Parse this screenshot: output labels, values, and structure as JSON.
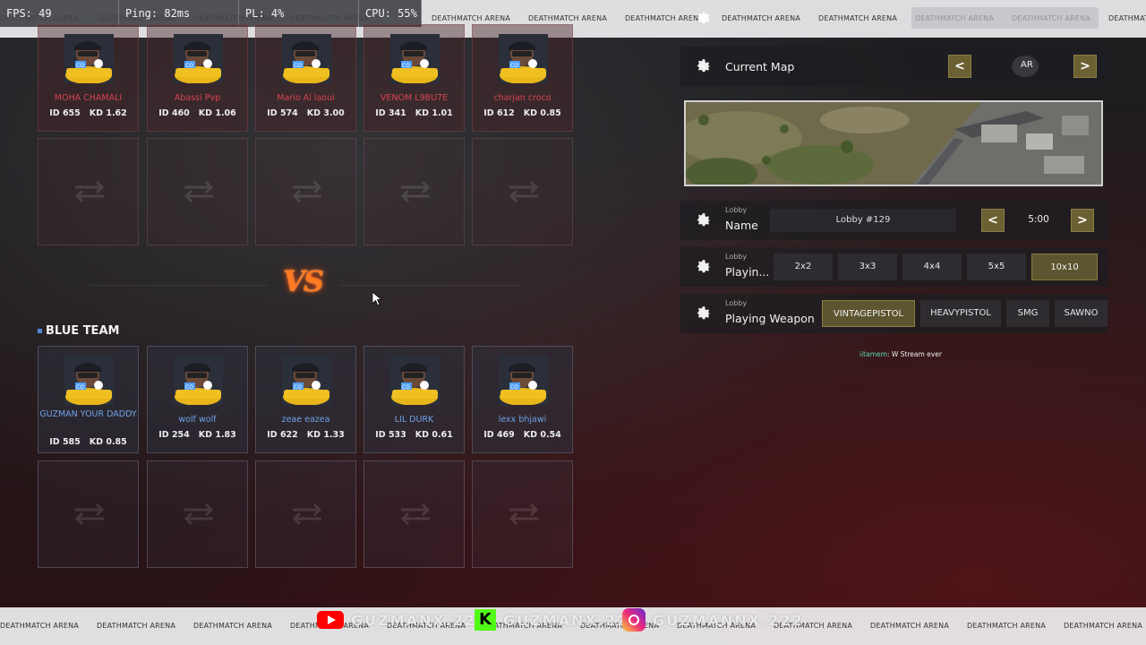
{
  "stats": {
    "fps": "FPS: 49",
    "ping": "Ping: 82ms",
    "pl": "PL: 4%",
    "cpu": "CPU: 55%"
  },
  "marquee_text": "DEATHMATCH ARENA",
  "social": {
    "youtube": "GUZMANX.222",
    "kick": "GUZMANX.222",
    "instagram": "GUZMANNX.222",
    "colors": {
      "youtube": "#ff0000",
      "kick": "#53fc18"
    }
  },
  "red_team": {
    "players": [
      {
        "name": "MOHA CHAMALI",
        "id": "ID 655",
        "kd": "KD 1.62"
      },
      {
        "name": "Abassi Pvp",
        "id": "ID 460",
        "kd": "KD 1.06"
      },
      {
        "name": "Mario Al laoui",
        "id": "ID 574",
        "kd": "KD 3.00"
      },
      {
        "name": "VENOM L9BU7E",
        "id": "ID 341",
        "kd": "KD 1.01"
      },
      {
        "name": "charjan croco",
        "id": "ID 612",
        "kd": "KD 0.85"
      }
    ],
    "color": "#d8434f"
  },
  "blue_team": {
    "label": "BLUE TEAM",
    "players": [
      {
        "name": "GUZMAN YOUR DADDY",
        "id": "ID 585",
        "kd": "KD 0.85"
      },
      {
        "name": "wolf wolf",
        "id": "ID 254",
        "kd": "KD 1.83"
      },
      {
        "name": "zeae eazea",
        "id": "ID 622",
        "kd": "KD 1.33"
      },
      {
        "name": "LIL DURK",
        "id": "ID 533",
        "kd": "KD 0.61"
      },
      {
        "name": "lexx bhjawi",
        "id": "ID 469",
        "kd": "KD 0.54"
      }
    ],
    "color": "#6ea2e6"
  },
  "vs": "VS",
  "settings": {
    "current_map": {
      "title": "Current Map",
      "value": "AR",
      "prev": "<",
      "next": ">"
    },
    "lobby_name": {
      "sub": "Lobby",
      "title": "Name",
      "value": "Lobby #129",
      "time": "5:00",
      "prev": "<",
      "next": ">"
    },
    "playing_mode": {
      "sub": "Lobby",
      "title": "Playin...",
      "options": [
        "2x2",
        "3x3",
        "4x4",
        "5x5",
        "10x10"
      ],
      "selected": "10x10"
    },
    "playing_weapon": {
      "sub": "Lobby",
      "title": "Playing Weapon",
      "options": [
        "VINTAGEPISTOL",
        "HEAVYPISTOL",
        "SMG",
        "SAWNO"
      ],
      "selected": "VINTAGEPISTOL"
    }
  },
  "chat": {
    "user": "iitamem",
    "message": ": W Stream ever"
  },
  "accent_color": "#6b6031"
}
